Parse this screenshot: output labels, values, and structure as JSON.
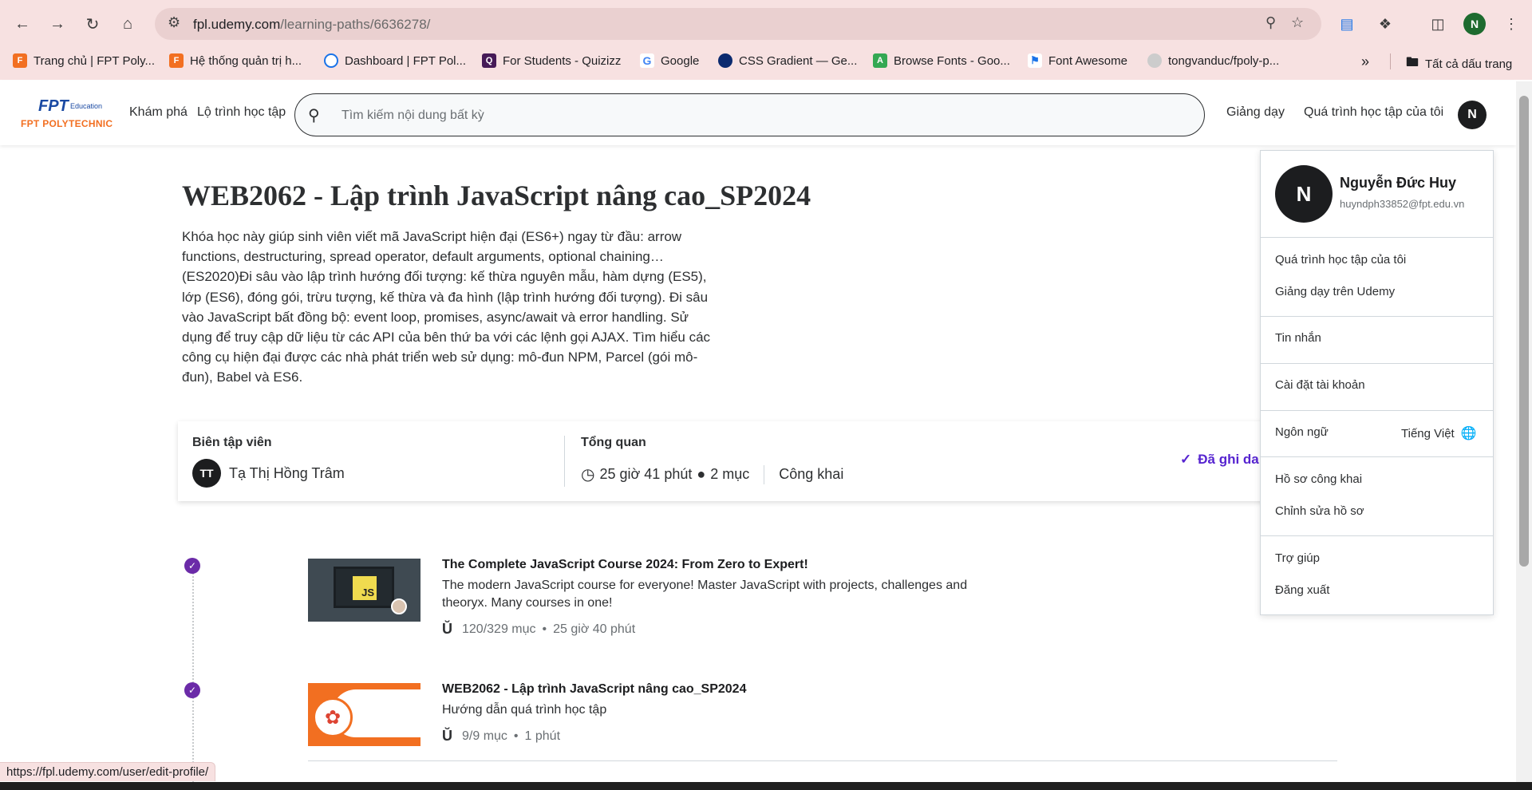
{
  "browser": {
    "url_host": "fpl.udemy.com",
    "url_path": "/learning-paths/6636278/",
    "profile_initial": "N",
    "bookmarks": [
      {
        "label": "Trang chủ | FPT Poly...",
        "icon": "fpt-favicon"
      },
      {
        "label": "Hệ thống quản trị h...",
        "icon": "fpt-favicon"
      },
      {
        "label": "Dashboard | FPT Pol...",
        "icon": "dashboard-favicon"
      },
      {
        "label": "For Students - Quizizz",
        "icon": "quizizz-favicon"
      },
      {
        "label": "Google",
        "icon": "google-favicon"
      },
      {
        "label": "CSS Gradient — Ge...",
        "icon": "cssgradient-favicon"
      },
      {
        "label": "Browse Fonts - Goo...",
        "icon": "googlefonts-favicon"
      },
      {
        "label": "Font Awesome",
        "icon": "fontawesome-favicon"
      },
      {
        "label": "tongvanduc/fpoly-p...",
        "icon": "github-favicon"
      }
    ],
    "all_bookmarks_label": "Tất cả dấu trang",
    "status_url": "https://fpl.udemy.com/user/edit-profile/"
  },
  "header": {
    "logo_fpt": "FPT",
    "logo_education": "Education",
    "logo_polytechnic": "FPT POLYTECHNIC",
    "explore": "Khám phá",
    "learning_path": "Lộ trình học tập",
    "search_placeholder": "Tìm kiếm nội dung bất kỳ",
    "teaching": "Giảng dạy",
    "my_learning": "Quá trình học tập của tôi",
    "avatar_initial": "N"
  },
  "path": {
    "title": "WEB2062 - Lập trình JavaScript nâng cao_SP2024",
    "description": "Khóa học này giúp sinh viên viết mã JavaScript hiện đại (ES6+) ngay từ đầu: arrow functions, destructuring, spread operator, default arguments, optional chaining…(ES2020)Đi sâu vào lập trình hướng đối tượng: kế thừa nguyên mẫu, hàm dựng (ES5), lớp (ES6), đóng gói, trừu tượng, kế thừa và đa hình (lập trình hướng đối tượng). Đi sâu vào JavaScript bất đồng bộ: event loop, promises, async/await và error handling. Sử dụng để truy cập dữ liệu từ các API của bên thứ ba với các lệnh gọi AJAX. Tìm hiểu các công cụ hiện đại được các nhà phát triển web sử dụng: mô-đun NPM, Parcel (gói mô-đun), Babel và ES6.",
    "editor_label": "Biên tập viên",
    "editor_initials": "TT",
    "editor_name": "Tạ Thị Hồng Trâm",
    "overview_label": "Tổng quan",
    "duration": "25 giờ 41 phút",
    "items": "2 mục",
    "visibility": "Công khai",
    "enrolled": "Đã ghi da"
  },
  "courses": [
    {
      "title": "The Complete JavaScript Course 2024: From Zero to Expert!",
      "subtitle": "The modern JavaScript course for everyone! Master JavaScript with projects, challenges and theoryx. Many courses in one!",
      "progress": "120/329 mục",
      "duration": "25 giờ 40 phút",
      "badge": "JS"
    },
    {
      "title": "WEB2062 - Lập trình JavaScript nâng cao_SP2024",
      "subtitle": "Hướng dẫn quá trình học tập",
      "progress": "9/9 mục",
      "duration": "1 phút"
    }
  ],
  "dropdown": {
    "avatar_initial": "N",
    "name": "Nguyễn Đức Huy",
    "email": "huyndph33852@fpt.edu.vn",
    "my_learning": "Quá trình học tập của tôi",
    "teach_on_udemy": "Giảng dạy trên Udemy",
    "messages": "Tin nhắn",
    "account_settings": "Cài đặt tài khoản",
    "language_label": "Ngôn ngữ",
    "language_value": "Tiếng Việt",
    "public_profile": "Hồ sơ công khai",
    "edit_profile": "Chỉnh sửa hồ sơ",
    "help": "Trợ giúp",
    "logout": "Đăng xuất"
  },
  "colors": {
    "accent_purple": "#5624d0",
    "check_purple": "#6b2ba8",
    "chrome_pink": "#f7e1e1",
    "fpt_orange": "#f26f21"
  }
}
